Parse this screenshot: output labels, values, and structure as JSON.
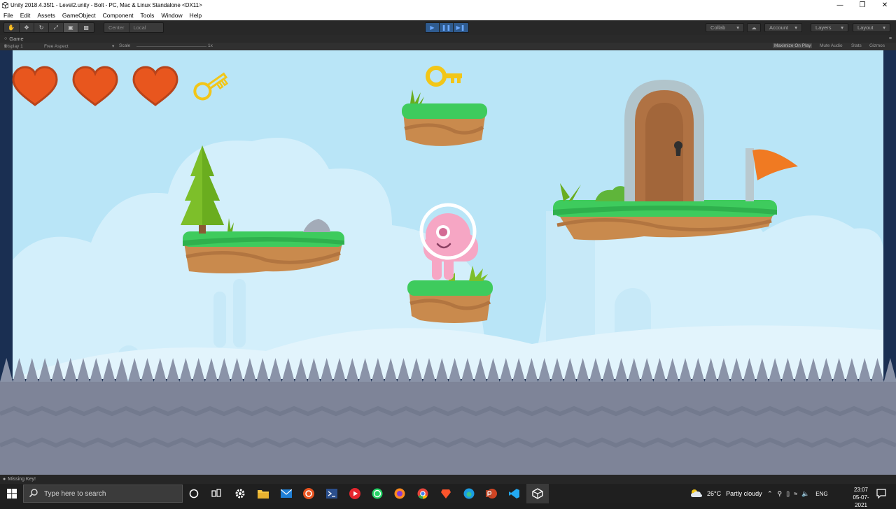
{
  "window": {
    "title": "Unity 2018.4.35f1 - Level2.unity - Bolt - PC, Mac & Linux Standalone <DX11>"
  },
  "menu": {
    "items": [
      "File",
      "Edit",
      "Assets",
      "GameObject",
      "Component",
      "Tools",
      "Window",
      "Help"
    ]
  },
  "toolbar": {
    "pivot_center": "Center",
    "pivot_local": "Local",
    "collab": "Collab",
    "account": "Account",
    "layers": "Layers",
    "layout": "Layout"
  },
  "game_tab": {
    "label": "Game"
  },
  "game_options": {
    "display": "Display 1",
    "aspect": "Free Aspect",
    "scale_label": "Scale",
    "scale_value": "1x",
    "maximize": "Maximize On Play",
    "mute": "Mute Audio",
    "stats": "Stats",
    "gizmos": "Gizmos"
  },
  "game": {
    "hearts_full": 3,
    "keys_collected": 0
  },
  "status": {
    "message": "Missing Key!"
  },
  "taskbar": {
    "search_placeholder": "Type here to search",
    "weather_temp": "26°C",
    "weather_text": "Partly cloudy",
    "language": "ENG",
    "time": "23:07",
    "date": "05-07-2021"
  },
  "colors": {
    "sky": "#b9e5f7",
    "grass": "#3ecb5d",
    "dirt": "#c98a4d",
    "heart": "#e8561e",
    "key": "#f2c618",
    "flag": "#f07a22",
    "spikes": "#8a93a8"
  }
}
